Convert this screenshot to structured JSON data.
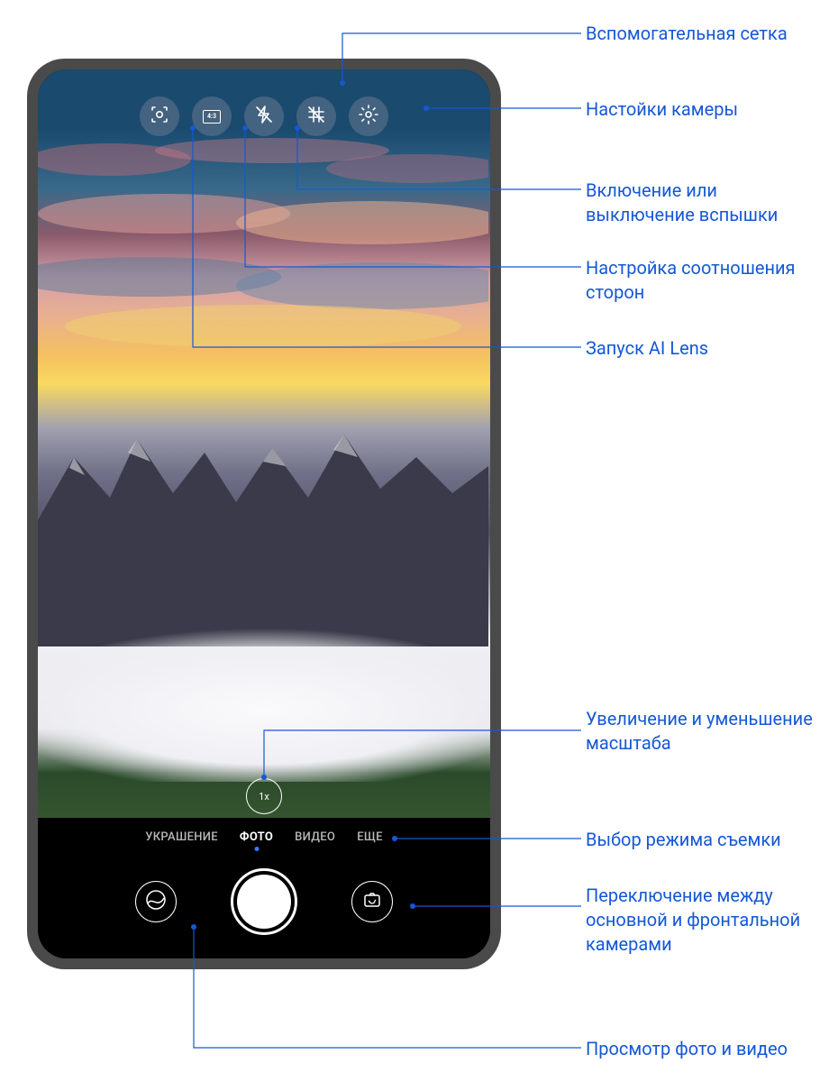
{
  "annotations": {
    "grid": "Вспомогательная сетка",
    "settings": "Настойки камеры",
    "flash": "Включение или выключение вспышки",
    "aspect": "Настройка соотношения сторон",
    "ailens": "Запуск AI Lens",
    "zoom": "Увеличение и уменьшение масштаба",
    "mode_select": "Выбор режима съемки",
    "switch_cam": "Переключение между основной и фронтальной камерами",
    "gallery": "Просмотр фото и видео"
  },
  "camera": {
    "aspect_label": "4:3",
    "zoom_label": "1x",
    "modes": {
      "beauty": "УКРАШЕНИЕ",
      "photo": "ФОТО",
      "video": "ВИДЕО",
      "more": "ЕЩЕ"
    },
    "active_mode": "photo"
  }
}
